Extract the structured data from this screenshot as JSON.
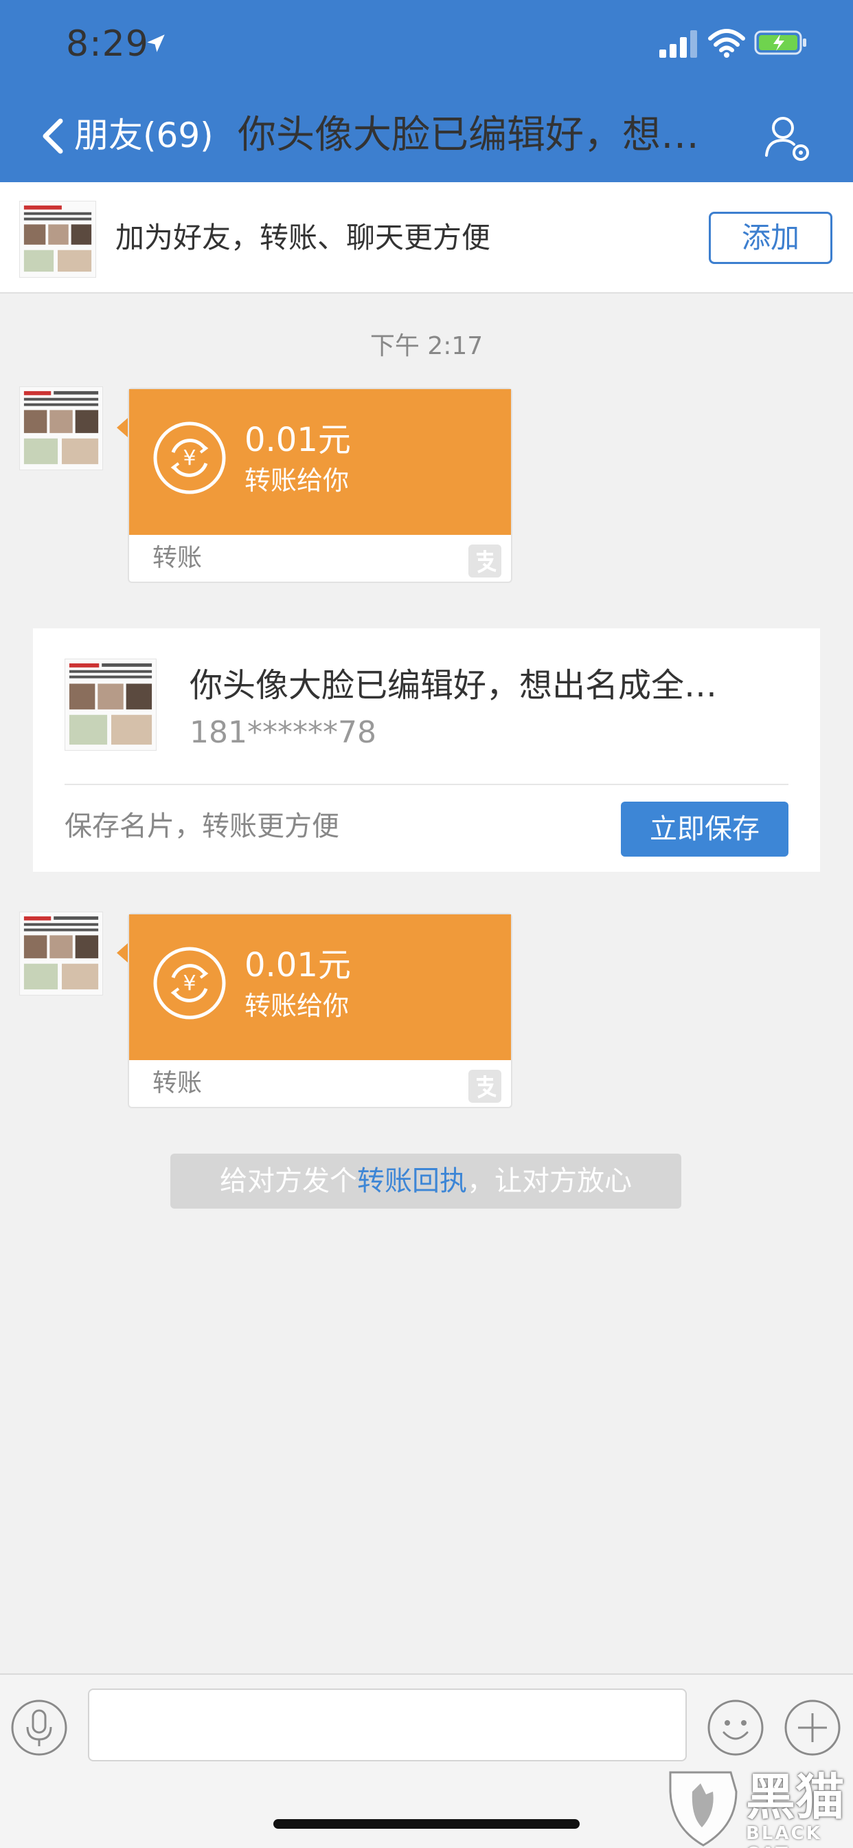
{
  "status_bar": {
    "time": "8:29"
  },
  "header": {
    "back_label": "朋友(69)",
    "title": "你头像大脸已编辑好，想…"
  },
  "add_friend_bar": {
    "text": "加为好友，转账、聊天更方便",
    "button_label": "添加"
  },
  "timestamp": "下午 2:17",
  "transfers": [
    {
      "amount": "0.01元",
      "description": "转账给你",
      "footer_label": "转账"
    },
    {
      "amount": "0.01元",
      "description": "转账给你",
      "footer_label": "转账"
    }
  ],
  "contact_card": {
    "name": "你头像大脸已编辑好，想出名成全…",
    "phone": "181******78",
    "hint": "保存名片，转账更方便",
    "button_label": "立即保存"
  },
  "receipt_notice": {
    "prefix": "给对方发个",
    "link": "转账回执",
    "suffix": "，让对方放心"
  },
  "input_bar": {
    "placeholder": ""
  },
  "watermark": {
    "text": "黑猫",
    "sub": "BLACK CAT"
  },
  "colors": {
    "header_blue": "#3d7fcf",
    "transfer_orange": "#f09a3a",
    "save_blue": "#3d86d6",
    "background": "#f1f1f1"
  },
  "icons": [
    "location-arrow-icon",
    "signal-icon",
    "wifi-icon",
    "battery-charging-icon",
    "chevron-left-icon",
    "person-settings-icon",
    "yuan-transfer-icon",
    "alipay-icon",
    "voice-icon",
    "emoji-icon",
    "plus-icon"
  ]
}
